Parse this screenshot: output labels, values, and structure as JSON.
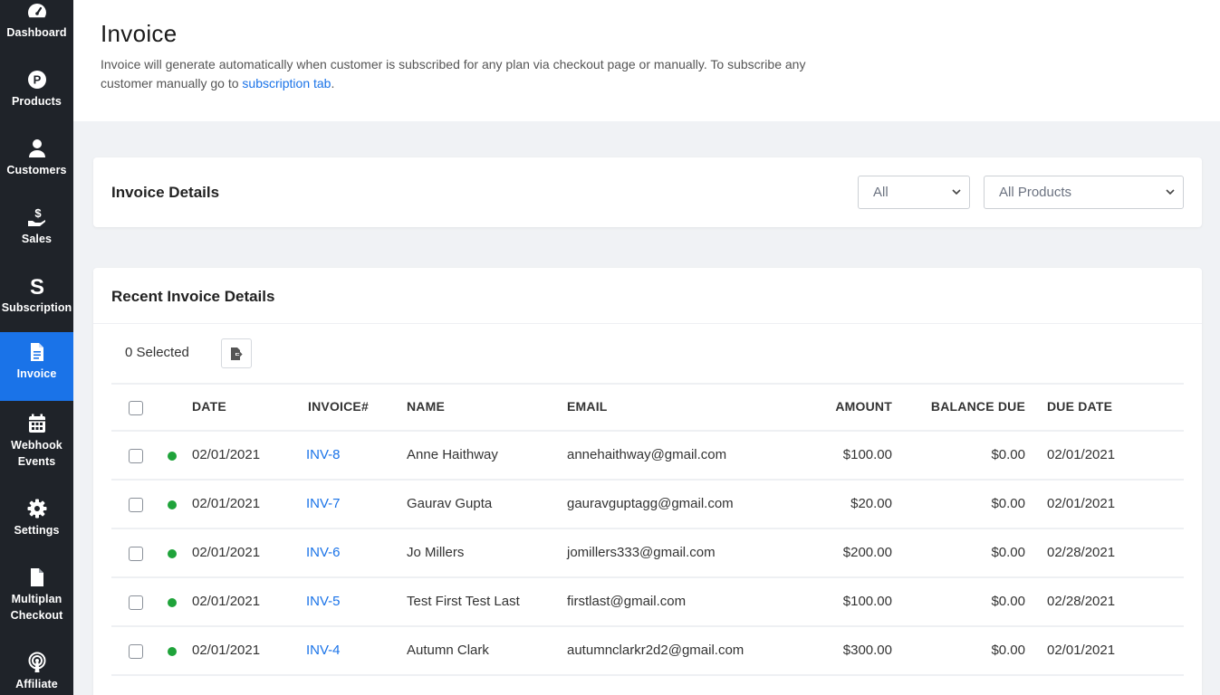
{
  "sidebar": {
    "items": [
      {
        "label": "Dashboard",
        "icon": "dashboard-icon"
      },
      {
        "label": "Products",
        "icon": "products-icon"
      },
      {
        "label": "Customers",
        "icon": "user-icon"
      },
      {
        "label": "Sales",
        "icon": "dollar-hand-icon"
      },
      {
        "label": "Subscription",
        "icon": "subscription-icon"
      },
      {
        "label": "Invoice",
        "icon": "document-icon",
        "active": true
      },
      {
        "label_line1": "Webhook",
        "label_line2": "Events",
        "icon": "calendar-icon"
      },
      {
        "label": "Settings",
        "icon": "gear-icon"
      },
      {
        "label_line1": "Multiplan",
        "label_line2": "Checkout",
        "icon": "file-icon"
      },
      {
        "label": "Affiliate",
        "icon": "broadcast-icon"
      }
    ]
  },
  "header": {
    "title": "Invoice",
    "description": "Invoice will generate automatically when customer is subscribed for any plan via checkout page or manually. To subscribe any customer manually go to ",
    "link_text": "subscription tab",
    "description_end": "."
  },
  "filter": {
    "title": "Invoice Details",
    "status_selected": "All",
    "products_selected": "All Products"
  },
  "recent": {
    "title": "Recent Invoice Details",
    "selected_text": "0 Selected",
    "columns": {
      "date": "DATE",
      "invoice": "INVOICE#",
      "name": "NAME",
      "email": "EMAIL",
      "amount": "AMOUNT",
      "balance": "BALANCE DUE",
      "due": "DUE DATE"
    },
    "rows": [
      {
        "date": "02/01/2021",
        "invoice": "INV-8",
        "name": "Anne Haithway",
        "email": "annehaithway@gmail.com",
        "amount": "$100.00",
        "balance": "$0.00",
        "due": "02/01/2021"
      },
      {
        "date": "02/01/2021",
        "invoice": "INV-7",
        "name": "Gaurav Gupta",
        "email": "gauravguptagg@gmail.com",
        "amount": "$20.00",
        "balance": "$0.00",
        "due": "02/01/2021"
      },
      {
        "date": "02/01/2021",
        "invoice": "INV-6",
        "name": "Jo Millers",
        "email": "jomillers333@gmail.com",
        "amount": "$200.00",
        "balance": "$0.00",
        "due": "02/28/2021"
      },
      {
        "date": "02/01/2021",
        "invoice": "INV-5",
        "name": "Test First Test Last",
        "email": "firstlast@gmail.com",
        "amount": "$100.00",
        "balance": "$0.00",
        "due": "02/28/2021"
      },
      {
        "date": "02/01/2021",
        "invoice": "INV-4",
        "name": "Autumn Clark",
        "email": "autumnclarkr2d2@gmail.com",
        "amount": "$300.00",
        "balance": "$0.00",
        "due": "02/01/2021"
      }
    ],
    "status_color": "#1fa33a"
  },
  "colors": {
    "sidebar_bg": "#1f2329",
    "accent": "#1a73e8"
  }
}
